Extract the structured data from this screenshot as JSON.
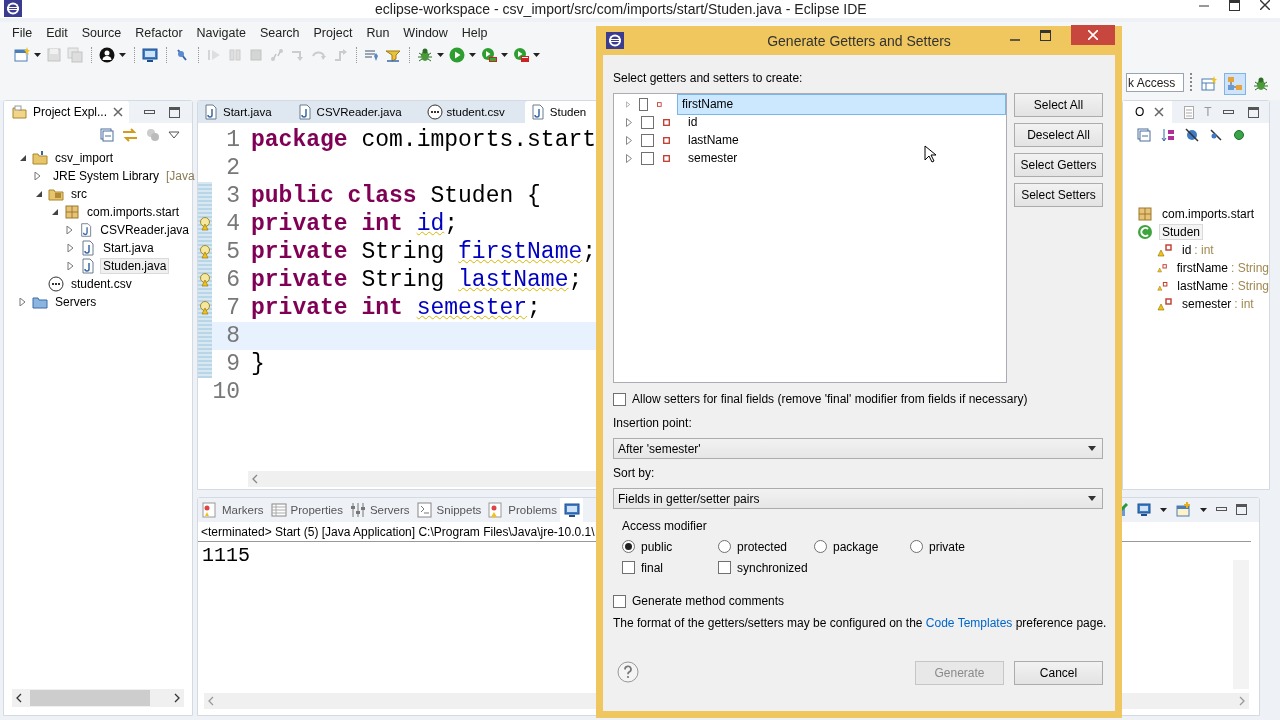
{
  "window": {
    "title": "eclipse-workspace - csv_import/src/com/imports/start/Studen.java - Eclipse IDE"
  },
  "menu": [
    "File",
    "Edit",
    "Source",
    "Refactor",
    "Navigate",
    "Search",
    "Project",
    "Run",
    "Window",
    "Help"
  ],
  "toolbar": [
    {
      "kind": "new",
      "disabled": false,
      "dropdown": true
    },
    {
      "kind": "save",
      "disabled": true,
      "dropdown": false
    },
    {
      "kind": "save-all",
      "disabled": true,
      "dropdown": false
    },
    {
      "kind": "sep"
    },
    {
      "kind": "person",
      "disabled": false,
      "dropdown": true
    },
    {
      "kind": "sep"
    },
    {
      "kind": "monitor",
      "disabled": false,
      "dropdown": false
    },
    {
      "kind": "sep"
    },
    {
      "kind": "pin-off",
      "disabled": false,
      "dropdown": false
    },
    {
      "kind": "sep"
    },
    {
      "kind": "resume",
      "disabled": true,
      "dropdown": false
    },
    {
      "kind": "suspend",
      "disabled": true,
      "dropdown": false
    },
    {
      "kind": "stop",
      "disabled": true,
      "dropdown": false
    },
    {
      "kind": "disconnect",
      "disabled": true,
      "dropdown": false
    },
    {
      "kind": "step-into",
      "disabled": true,
      "dropdown": false
    },
    {
      "kind": "step-over",
      "disabled": true,
      "dropdown": false
    },
    {
      "kind": "step-return",
      "disabled": true,
      "dropdown": false
    },
    {
      "kind": "sep"
    },
    {
      "kind": "lines",
      "disabled": false,
      "dropdown": false
    },
    {
      "kind": "filter",
      "disabled": false,
      "dropdown": false
    },
    {
      "kind": "sep"
    },
    {
      "kind": "debug",
      "disabled": false,
      "dropdown": true
    },
    {
      "kind": "run",
      "disabled": false,
      "dropdown": true
    },
    {
      "kind": "coverage",
      "disabled": false,
      "dropdown": true
    },
    {
      "kind": "external",
      "disabled": false,
      "dropdown": true
    }
  ],
  "quick_access": {
    "placeholder": "k Access"
  },
  "perspectives": [
    {
      "kind": "open",
      "selected": false
    },
    {
      "kind": "java",
      "selected": true
    },
    {
      "kind": "debug",
      "selected": false
    }
  ],
  "project_explorer": {
    "title": "Project Expl...",
    "tree": [
      {
        "label": "csv_import",
        "kind": "project",
        "expanded": true,
        "selected": false,
        "children": [
          {
            "label": "JRE System Library",
            "detail": "[Java",
            "kind": "library",
            "expanded": false,
            "selected": false
          },
          {
            "label": "src",
            "kind": "source",
            "expanded": true,
            "selected": false,
            "children": [
              {
                "label": "com.imports.start",
                "kind": "package",
                "expanded": true,
                "selected": false,
                "children": [
                  {
                    "label": "CSVReader.java",
                    "kind": "java",
                    "expanded": false,
                    "selected": false
                  },
                  {
                    "label": "Start.java",
                    "kind": "java",
                    "expanded": false,
                    "selected": false
                  },
                  {
                    "label": "Studen.java",
                    "kind": "java",
                    "expanded": false,
                    "selected": true
                  }
                ]
              }
            ]
          },
          {
            "label": "student.csv",
            "kind": "csv",
            "selected": false
          }
        ]
      },
      {
        "label": "Servers",
        "kind": "folder",
        "expanded": false,
        "selected": false
      }
    ]
  },
  "editor": {
    "tabs": [
      {
        "label": "Start.java",
        "kind": "java",
        "selected": false
      },
      {
        "label": "CSVReader.java",
        "kind": "java",
        "selected": false
      },
      {
        "label": "student.csv",
        "kind": "csv",
        "selected": false
      },
      {
        "label": "Studen",
        "kind": "java",
        "selected": true
      }
    ],
    "lines": [
      {
        "number": "1",
        "warning": false,
        "current": false,
        "changed": false,
        "tokens": [
          {
            "kind": "keyword",
            "text": "package "
          },
          {
            "kind": "plain",
            "text": "com.imports.start"
          }
        ]
      },
      {
        "number": "2",
        "warning": false,
        "current": false,
        "changed": false
      },
      {
        "number": "3",
        "warning": false,
        "current": false,
        "changed": true,
        "tokens": [
          {
            "kind": "keyword",
            "text": "public class "
          },
          {
            "kind": "plain",
            "text": "Studen {"
          }
        ]
      },
      {
        "number": "4",
        "warning": true,
        "current": false,
        "changed": true,
        "tokens": [
          {
            "kind": "keyword",
            "text": "private int "
          },
          {
            "kind": "field",
            "text": "id"
          },
          {
            "kind": "plain",
            "text": ";"
          }
        ]
      },
      {
        "number": "5",
        "warning": true,
        "current": false,
        "changed": true,
        "tokens": [
          {
            "kind": "keyword",
            "text": "private "
          },
          {
            "kind": "plain",
            "text": "String "
          },
          {
            "kind": "field",
            "text": "firstName"
          },
          {
            "kind": "plain",
            "text": ";"
          }
        ]
      },
      {
        "number": "6",
        "warning": true,
        "current": false,
        "changed": true,
        "tokens": [
          {
            "kind": "keyword",
            "text": "private "
          },
          {
            "kind": "plain",
            "text": "String "
          },
          {
            "kind": "field",
            "text": "lastName"
          },
          {
            "kind": "plain",
            "text": ";"
          }
        ]
      },
      {
        "number": "7",
        "warning": true,
        "current": false,
        "changed": true,
        "tokens": [
          {
            "kind": "keyword",
            "text": "private int "
          },
          {
            "kind": "field",
            "text": "semester"
          },
          {
            "kind": "plain",
            "text": ";"
          }
        ]
      },
      {
        "number": "8",
        "warning": false,
        "current": true,
        "changed": true
      },
      {
        "number": "9",
        "warning": false,
        "current": false,
        "changed": true,
        "tokens": [
          {
            "kind": "plain",
            "text": "}"
          }
        ]
      },
      {
        "number": "10",
        "warning": false,
        "current": false,
        "changed": false
      }
    ]
  },
  "console": {
    "tabs": [
      {
        "label": "Markers",
        "kind": "markers",
        "selected": false
      },
      {
        "label": "Properties",
        "kind": "properties",
        "selected": false
      },
      {
        "label": "Servers",
        "kind": "servers",
        "selected": false
      },
      {
        "label": "Snippets",
        "kind": "snippets",
        "selected": false
      },
      {
        "label": "Problems",
        "kind": "problems",
        "selected": false
      },
      {
        "kind": "console",
        "selected": true
      }
    ],
    "header": "<terminated> Start (5) [Java Application] C:\\Program Files\\Java\\jre-10.0.1\\",
    "output": "1115"
  },
  "outline": {
    "tabs": [
      {
        "label": "O",
        "selected": true
      },
      {
        "label": "T",
        "selected": false
      }
    ],
    "tree": [
      {
        "label": "com.imports.start",
        "kind": "package",
        "selected": false
      },
      {
        "label": "Studen",
        "kind": "class",
        "selected": true,
        "children": [
          {
            "label": "id",
            "detail": ": int",
            "kind": "field",
            "selected": false
          },
          {
            "label": "firstName",
            "detail": ": String",
            "kind": "field",
            "selected": false
          },
          {
            "label": "lastName",
            "detail": ": String",
            "kind": "field",
            "selected": false
          },
          {
            "label": "semester",
            "detail": ": int",
            "kind": "field",
            "selected": false
          }
        ]
      }
    ]
  },
  "dialog": {
    "title": "Generate Getters and Setters",
    "prompt": "Select getters and setters to create:",
    "fields": [
      {
        "label": "firstName",
        "checked": false,
        "selected": true
      },
      {
        "label": "id",
        "checked": false,
        "selected": false
      },
      {
        "label": "lastName",
        "checked": false,
        "selected": false
      },
      {
        "label": "semester",
        "checked": false,
        "selected": false
      }
    ],
    "side_buttons": [
      "Select All",
      "Deselect All",
      "Select Getters",
      "Select Setters"
    ],
    "allow_final": {
      "label": "Allow setters for final fields (remove 'final' modifier from fields if necessary)",
      "checked": false
    },
    "insertion_point": {
      "label": "Insertion point:",
      "value": "After 'semester'"
    },
    "sort_by": {
      "label": "Sort by:",
      "value": "Fields in getter/setter pairs"
    },
    "access": {
      "title": "Access modifier",
      "options": [
        {
          "label": "public",
          "selected": true
        },
        {
          "label": "protected",
          "selected": false
        },
        {
          "label": "package",
          "selected": false
        },
        {
          "label": "private",
          "selected": false
        }
      ],
      "flags": [
        {
          "label": "final",
          "checked": false
        },
        {
          "label": "synchronized",
          "checked": false
        }
      ]
    },
    "comments": {
      "label": "Generate method comments",
      "checked": false
    },
    "note": {
      "before": "The format of the getters/setters may be configured on the",
      "link": "Code Templates",
      "after": "preference page."
    },
    "buttons": [
      {
        "label": "Generate",
        "disabled": true
      },
      {
        "label": "Cancel",
        "disabled": false
      }
    ]
  }
}
